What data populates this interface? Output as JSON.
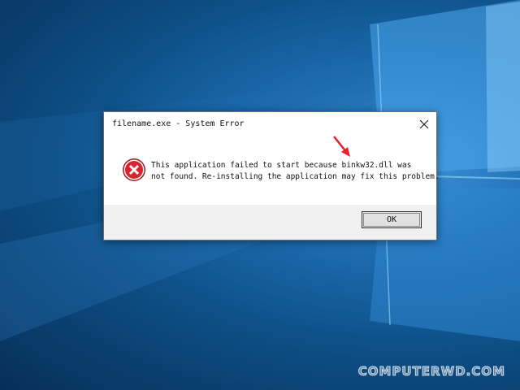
{
  "dialog": {
    "title": "filename.exe - System Error",
    "message_line1": "This application failed to start because binkw32.dll was",
    "message_line2": "not found. Re-installing the application may fix this problem.",
    "ok_label": "OK"
  },
  "icons": {
    "error": "error-icon",
    "close": "close-icon",
    "annotation": "red-arrow-icon"
  },
  "watermark": "COMPUTERWD.COM",
  "colors": {
    "desktop_blue": "#0d4f86",
    "error_red": "#d9232e",
    "arrow_red": "#e8202a"
  }
}
